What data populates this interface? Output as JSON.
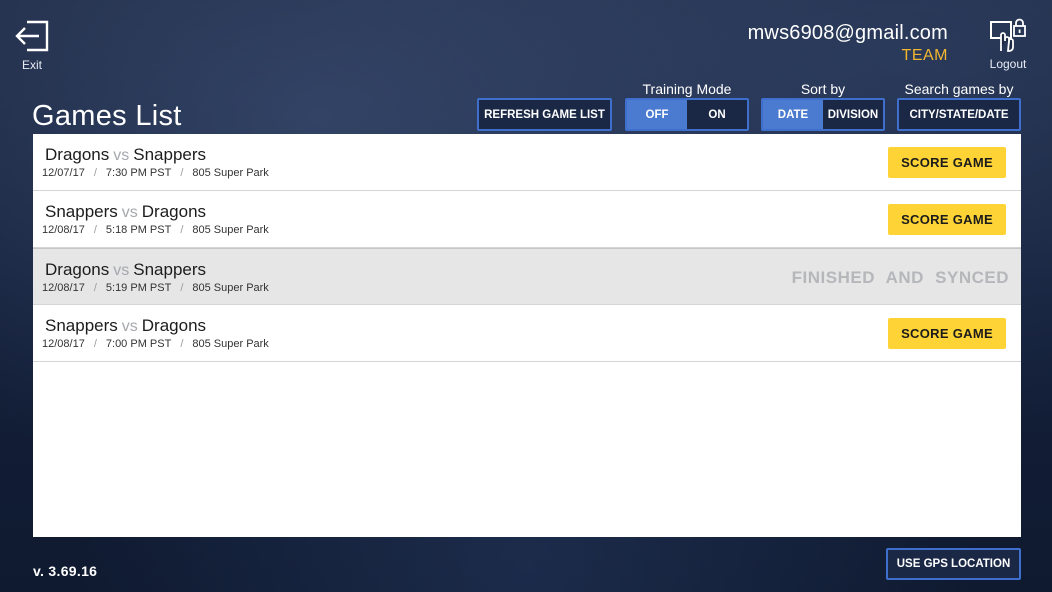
{
  "header": {
    "exit_label": "Exit",
    "account_email": "mws6908@gmail.com",
    "account_role": "TEAM",
    "logout_label": "Logout",
    "page_title": "Games List"
  },
  "controls": {
    "refresh_label": "REFRESH GAME LIST",
    "training_mode": {
      "label": "Training Mode",
      "off": "OFF",
      "on": "ON",
      "selected": "OFF"
    },
    "sort_by": {
      "label": "Sort by",
      "date": "DATE",
      "division": "DIVISION",
      "selected": "DATE"
    },
    "search": {
      "label": "Search games by",
      "button": "CITY/STATE/DATE"
    }
  },
  "games": [
    {
      "home": "Dragons",
      "vs": "vs",
      "away": "Snappers",
      "date": "12/07/17",
      "time": "7:30 PM PST",
      "venue": "805 Super Park",
      "action": "SCORE GAME"
    },
    {
      "home": "Snappers",
      "vs": "vs",
      "away": "Dragons",
      "date": "12/08/17",
      "time": "5:18 PM PST",
      "venue": "805 Super Park",
      "action": "SCORE GAME"
    },
    {
      "home": "Dragons",
      "vs": "vs",
      "away": "Snappers",
      "date": "12/08/17",
      "time": "5:19 PM PST",
      "venue": "805 Super Park",
      "status": "FINISHED  AND SYNCED"
    },
    {
      "home": "Snappers",
      "vs": "vs",
      "away": "Dragons",
      "date": "12/08/17",
      "time": "7:00 PM PST",
      "venue": "805 Super Park",
      "action": "SCORE GAME"
    }
  ],
  "footer": {
    "version": "v. 3.69.16",
    "gps_label": "USE GPS LOCATION"
  },
  "icons": {
    "exit": "exit-icon",
    "logout": "logout-lock-icon",
    "separator": "/"
  },
  "colors": {
    "accent_blue": "#4a7bd0",
    "score_button": "#fdd335",
    "team_label": "#f2b72e"
  }
}
